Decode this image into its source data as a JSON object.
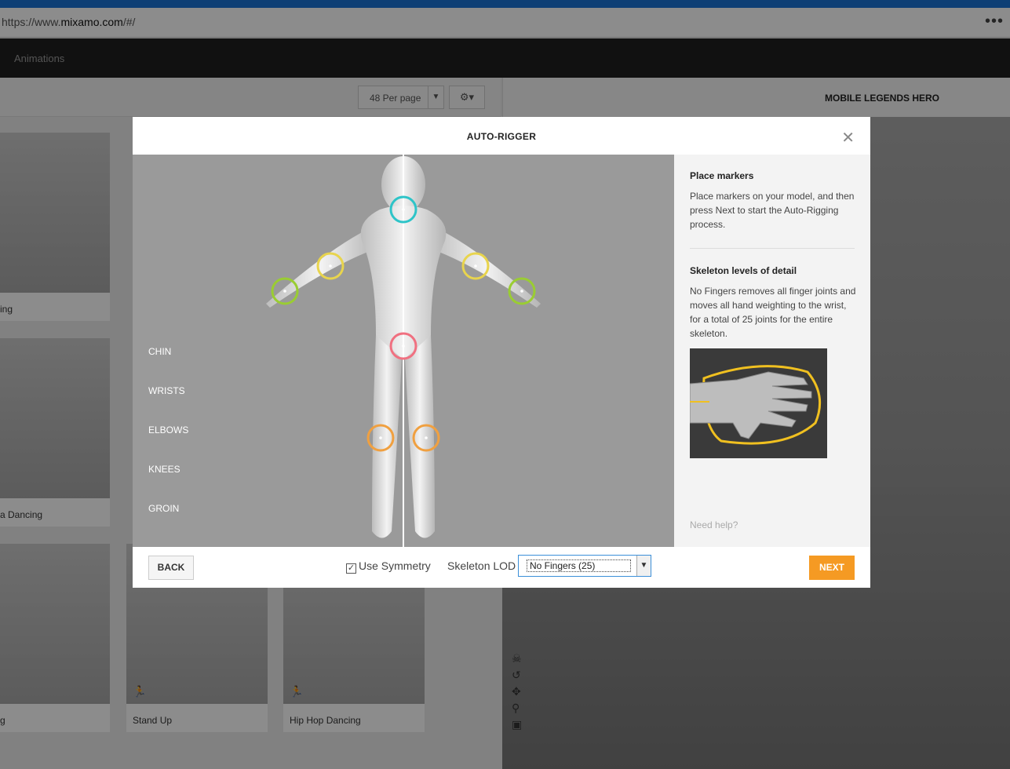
{
  "browser": {
    "url_prefix": "https://www.",
    "url_domain": "mixamo.com",
    "url_path": "/#/",
    "menu_icon": "more-horizontal-icon"
  },
  "nav": {
    "animations": "Animations"
  },
  "toolbar": {
    "per_page": "48 Per page",
    "settings_icon": "gear-icon"
  },
  "right_header": {
    "title": "MOBILE LEGENDS HERO"
  },
  "cards": [
    {
      "label": "ing",
      "color": "#3f5f6a"
    },
    {
      "label": "a Dancing",
      "color": "#8b3a35"
    },
    {
      "label": "g",
      "color": "#8b3a35"
    },
    {
      "label": "Stand Up",
      "color": "#3f5f6a"
    },
    {
      "label": "Hip Hop Dancing",
      "color": "#8b3a35"
    }
  ],
  "modal": {
    "title": "AUTO-RIGGER",
    "close_icon": "close-icon",
    "marker_labels": [
      "CHIN",
      "WRISTS",
      "ELBOWS",
      "KNEES",
      "GROIN"
    ],
    "marker_colors": {
      "chin": "#2ec4c8",
      "wrists": "#9acd32",
      "elbows": "#e8d44d",
      "knees": "#f0a040",
      "groin": "#f07080"
    },
    "info": {
      "place_heading": "Place markers",
      "place_text": "Place markers on your model, and then press Next to start the Auto-Rigging process.",
      "lod_heading": "Skeleton levels of detail",
      "lod_text": "No Fingers removes all finger joints and moves all hand weighting to the wrist, for a total of 25 joints for the entire skeleton.",
      "help": "Need help?"
    },
    "footer": {
      "back": "BACK",
      "symmetry_label": "Use Symmetry",
      "symmetry_checked": true,
      "lod_label": "Skeleton LOD",
      "lod_value": "No Fingers (25)",
      "next": "NEXT"
    },
    "accent": "#f59a23"
  }
}
